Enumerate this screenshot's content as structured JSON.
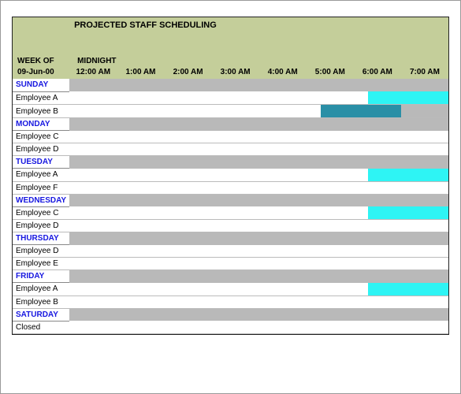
{
  "title": "PROJECTED STAFF SCHEDULING",
  "weekof_label": "WEEK OF",
  "weekof_value": "09-Jun-00",
  "midnight_label": "MIDNIGHT",
  "time_headers": [
    "12:00 AM",
    "1:00 AM",
    "2:00 AM",
    "3:00 AM",
    "4:00 AM",
    "5:00 AM",
    "6:00 AM",
    "7:00 AM"
  ],
  "colors": {
    "header_band": "#c4ce9a",
    "day_fill": "#b9b9b9",
    "day_text": "#1717e0",
    "cyan": "#2ef4f4",
    "teal": "#2a8fa6",
    "gray_bar": "#b9b9b9"
  },
  "rows": [
    {
      "type": "day",
      "label": "SUNDAY"
    },
    {
      "type": "emp",
      "label": "Employee A",
      "segments": [
        {
          "start": 0,
          "end": 6.3,
          "color": "none"
        },
        {
          "start": 6.3,
          "end": 8,
          "color": "cyan"
        }
      ]
    },
    {
      "type": "emp",
      "label": "Employee B",
      "segments": [
        {
          "start": 0,
          "end": 5.3,
          "color": "none"
        },
        {
          "start": 5.3,
          "end": 7,
          "color": "teal"
        },
        {
          "start": 7,
          "end": 8,
          "color": "gray_bar"
        }
      ]
    },
    {
      "type": "day",
      "label": "MONDAY",
      "bar_full": true
    },
    {
      "type": "emp",
      "label": "Employee C",
      "segments": []
    },
    {
      "type": "emp",
      "label": "Employee D",
      "segments": []
    },
    {
      "type": "day",
      "label": "TUESDAY",
      "bar_full": true
    },
    {
      "type": "emp",
      "label": "Employee A",
      "segments": [
        {
          "start": 0,
          "end": 6.3,
          "color": "none"
        },
        {
          "start": 6.3,
          "end": 8,
          "color": "cyan"
        }
      ]
    },
    {
      "type": "emp",
      "label": "Employee F",
      "segments": []
    },
    {
      "type": "day",
      "label": "WEDNESDAY",
      "bar_full": true
    },
    {
      "type": "emp",
      "label": "Employee C",
      "segments": [
        {
          "start": 0,
          "end": 6.3,
          "color": "none"
        },
        {
          "start": 6.3,
          "end": 8,
          "color": "cyan"
        }
      ]
    },
    {
      "type": "emp",
      "label": "Employee D",
      "segments": []
    },
    {
      "type": "day",
      "label": "THURSDAY",
      "bar_full": true
    },
    {
      "type": "emp",
      "label": "Employee D",
      "segments": []
    },
    {
      "type": "emp",
      "label": "Employee E",
      "segments": []
    },
    {
      "type": "day",
      "label": "FRIDAY",
      "bar_full": true
    },
    {
      "type": "emp",
      "label": "Employee A",
      "segments": [
        {
          "start": 0,
          "end": 6.3,
          "color": "none"
        },
        {
          "start": 6.3,
          "end": 8,
          "color": "cyan"
        }
      ]
    },
    {
      "type": "emp",
      "label": "Employee B",
      "segments": []
    },
    {
      "type": "day",
      "label": "SATURDAY",
      "bar_full": true
    },
    {
      "type": "emp",
      "label": "Closed",
      "segments": []
    }
  ]
}
